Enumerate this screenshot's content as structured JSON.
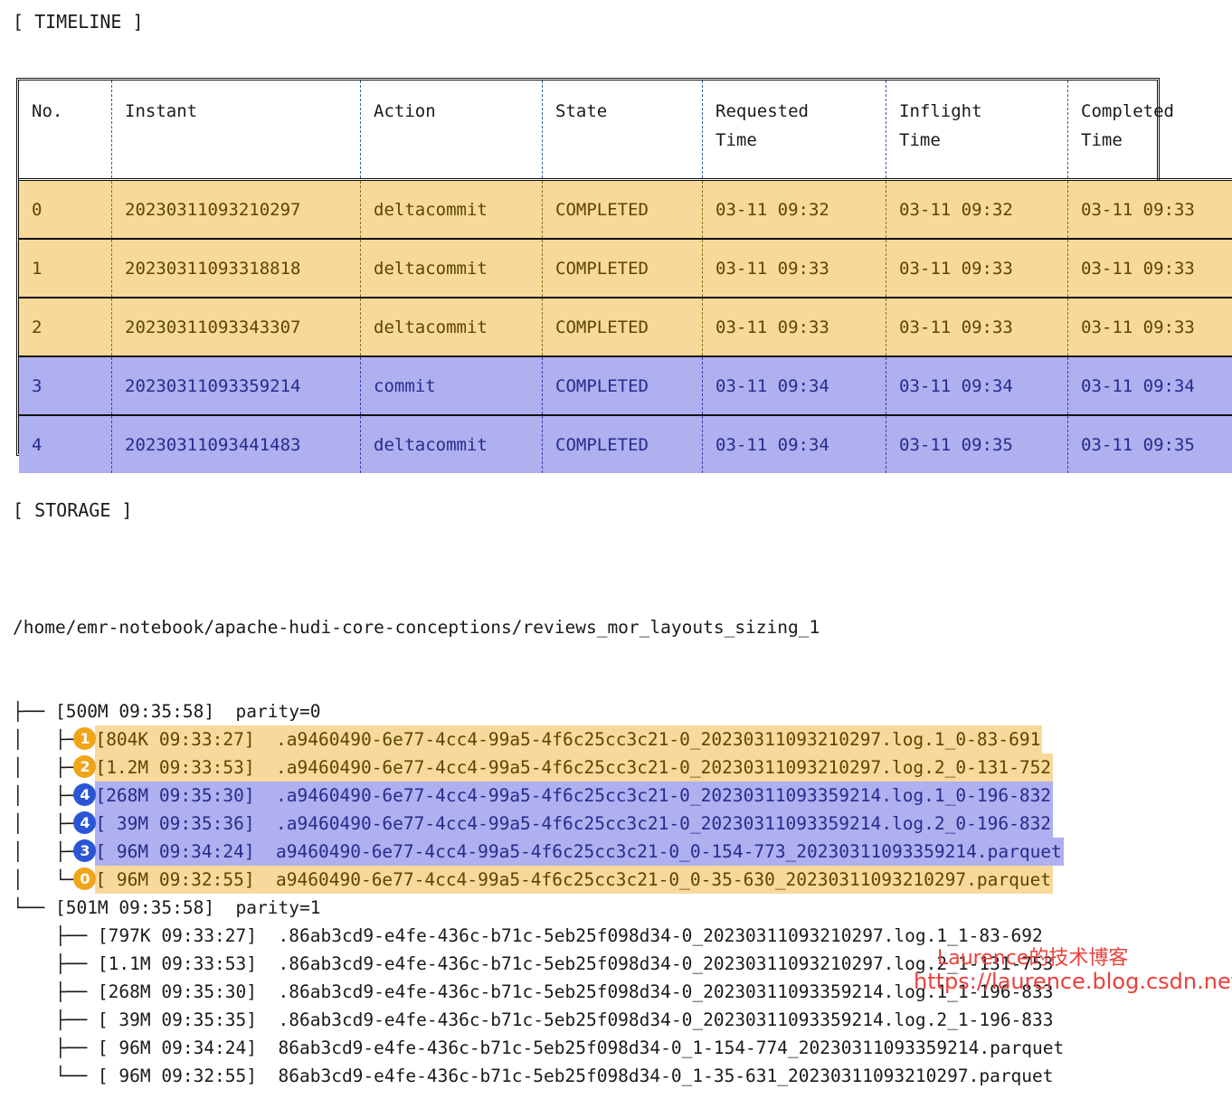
{
  "sections": {
    "timeline_label": "[ TIMELINE ]",
    "storage_label": "[ STORAGE ]"
  },
  "timeline": {
    "columns": [
      "No.",
      "Instant",
      "Action",
      "State",
      "Requested\nTime",
      "Inflight\nTime",
      "Completed\nTime"
    ],
    "rows": [
      {
        "no": "0",
        "instant": "20230311093210297",
        "action": "deltacommit",
        "state": "COMPLETED",
        "requested_time": "03-11 09:32",
        "inflight_time": "03-11 09:32",
        "completed_time": "03-11 09:33",
        "highlight": "amber"
      },
      {
        "no": "1",
        "instant": "20230311093318818",
        "action": "deltacommit",
        "state": "COMPLETED",
        "requested_time": "03-11 09:33",
        "inflight_time": "03-11 09:33",
        "completed_time": "03-11 09:33",
        "highlight": "amber"
      },
      {
        "no": "2",
        "instant": "20230311093343307",
        "action": "deltacommit",
        "state": "COMPLETED",
        "requested_time": "03-11 09:33",
        "inflight_time": "03-11 09:33",
        "completed_time": "03-11 09:33",
        "highlight": "amber"
      },
      {
        "no": "3",
        "instant": "20230311093359214",
        "action": "commit",
        "state": "COMPLETED",
        "requested_time": "03-11 09:34",
        "inflight_time": "03-11 09:34",
        "completed_time": "03-11 09:34",
        "highlight": "blue"
      },
      {
        "no": "4",
        "instant": "20230311093441483",
        "action": "deltacommit",
        "state": "COMPLETED",
        "requested_time": "03-11 09:34",
        "inflight_time": "03-11 09:35",
        "completed_time": "03-11 09:35",
        "highlight": "blue"
      }
    ]
  },
  "storage": {
    "root_path": "/home/emr-notebook/apache-hudi-core-conceptions/reviews_mor_layouts_sizing_1",
    "lines": [
      {
        "prefix": "├── ",
        "text": "[500M 09:35:58]  parity=0",
        "badge": null,
        "highlight": null
      },
      {
        "prefix": "│   ├─",
        "text": "[804K 09:33:27]  .a9460490-6e77-4cc4-99a5-4f6c25cc3c21-0_20230311093210297.log.1_0-83-691",
        "badge": "1",
        "highlight": "amber"
      },
      {
        "prefix": "│   ├─",
        "text": "[1.2M 09:33:53]  .a9460490-6e77-4cc4-99a5-4f6c25cc3c21-0_20230311093210297.log.2_0-131-752",
        "badge": "2",
        "highlight": "amber"
      },
      {
        "prefix": "│   ├─",
        "text": "[268M 09:35:30]  .a9460490-6e77-4cc4-99a5-4f6c25cc3c21-0_20230311093359214.log.1_0-196-832",
        "badge": "4",
        "highlight": "blue"
      },
      {
        "prefix": "│   ├─",
        "text": "[ 39M 09:35:36]  .a9460490-6e77-4cc4-99a5-4f6c25cc3c21-0_20230311093359214.log.2_0-196-832",
        "badge": "4",
        "highlight": "blue"
      },
      {
        "prefix": "│   ├─",
        "text": "[ 96M 09:34:24]  a9460490-6e77-4cc4-99a5-4f6c25cc3c21-0_0-154-773_20230311093359214.parquet",
        "badge": "3",
        "highlight": "blue"
      },
      {
        "prefix": "│   └─",
        "text": "[ 96M 09:32:55]  a9460490-6e77-4cc4-99a5-4f6c25cc3c21-0_0-35-630_20230311093210297.parquet",
        "badge": "0",
        "highlight": "amber"
      },
      {
        "prefix": "└── ",
        "text": "[501M 09:35:58]  parity=1",
        "badge": null,
        "highlight": null
      },
      {
        "prefix": "    ├── ",
        "text": "[797K 09:33:27]  .86ab3cd9-e4fe-436c-b71c-5eb25f098d34-0_20230311093210297.log.1_1-83-692",
        "badge": null,
        "highlight": null
      },
      {
        "prefix": "    ├── ",
        "text": "[1.1M 09:33:53]  .86ab3cd9-e4fe-436c-b71c-5eb25f098d34-0_20230311093210297.log.2_1-131-753",
        "badge": null,
        "highlight": null
      },
      {
        "prefix": "    ├── ",
        "text": "[268M 09:35:30]  .86ab3cd9-e4fe-436c-b71c-5eb25f098d34-0_20230311093359214.log.1_1-196-833",
        "badge": null,
        "highlight": null
      },
      {
        "prefix": "    ├── ",
        "text": "[ 39M 09:35:35]  .86ab3cd9-e4fe-436c-b71c-5eb25f098d34-0_20230311093359214.log.2_1-196-833",
        "badge": null,
        "highlight": null
      },
      {
        "prefix": "    ├── ",
        "text": "[ 96M 09:34:24]  86ab3cd9-e4fe-436c-b71c-5eb25f098d34-0_1-154-774_20230311093359214.parquet",
        "badge": null,
        "highlight": null
      },
      {
        "prefix": "    └── ",
        "text": "[ 96M 09:32:55]  86ab3cd9-e4fe-436c-b71c-5eb25f098d34-0_1-35-631_20230311093210297.parquet",
        "badge": null,
        "highlight": null
      }
    ]
  },
  "watermark": {
    "line1": "Laurence的技术博客",
    "line2": "https://laurence.blog.csdn.net",
    "color": "#e8413c"
  },
  "colors": {
    "amber_bg": "#f7d99a",
    "amber_text": "#5c4603",
    "blue_bg": "#aeb0f0",
    "blue_text": "#2a2a8c",
    "badge_amber": "#f0a519",
    "badge_blue": "#2a56d6"
  }
}
